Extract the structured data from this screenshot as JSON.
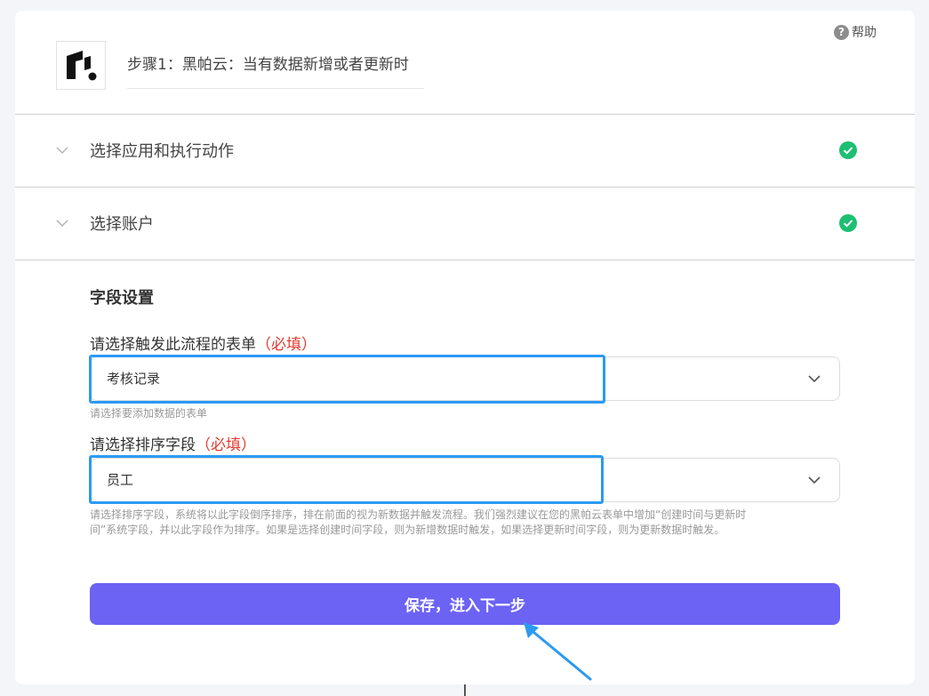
{
  "help": {
    "icon": "question-circle-icon",
    "label": "帮助"
  },
  "header": {
    "logo_icon": "heipayun-logo",
    "step_title": "步骤1：黑帕云：当有数据新增或者更新时"
  },
  "sections": [
    {
      "label": "选择应用和执行动作",
      "status": "complete",
      "status_icon": "check-circle-icon"
    },
    {
      "label": "选择账户",
      "status": "complete",
      "status_icon": "check-circle-icon"
    }
  ],
  "field_settings": {
    "title": "字段设置",
    "form_select": {
      "label": "请选择触发此流程的表单",
      "required": "（必填）",
      "value": "考核记录",
      "hint": "请选择要添加数据的表单"
    },
    "sort_select": {
      "label": "请选择排序字段",
      "required": "（必填）",
      "value": "员工",
      "hint_line1": "请选择排序字段，系统将以此字段倒序排序，排在前面的视为新数据并触发流程。我们强烈建议在您的黑帕云表单中增加“创建时间与更新时",
      "hint_line2": "间”系统字段，并以此字段作为排序。如果是选择创建时间字段，则为新增数据时触发，如果选择更新时间字段，则为更新数据时触发。"
    }
  },
  "save_button": {
    "label": "保存，进入下一步"
  },
  "colors": {
    "primary": "#6c62f4",
    "success": "#1dbf73",
    "highlight": "#2b9af3",
    "required": "#e23a2e"
  }
}
